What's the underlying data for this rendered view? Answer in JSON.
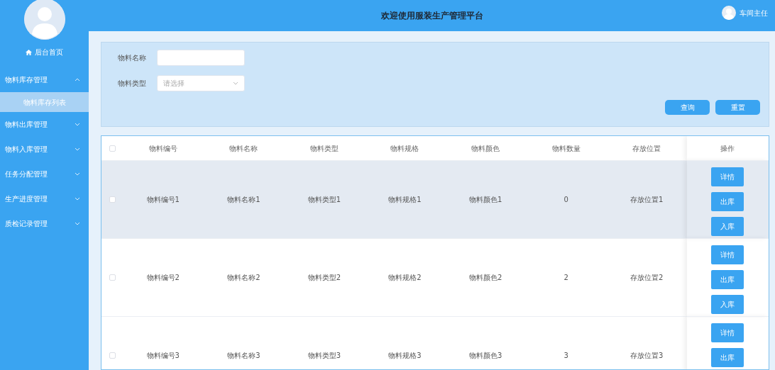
{
  "sidebar": {
    "home": "后台首页",
    "items": [
      {
        "label": "物料库存管理",
        "expanded": true,
        "children": [
          {
            "label": "物料库存列表",
            "selected": true
          }
        ]
      },
      {
        "label": "物料出库管理",
        "expanded": false
      },
      {
        "label": "物料入库管理",
        "expanded": false
      },
      {
        "label": "任务分配管理",
        "expanded": false
      },
      {
        "label": "生产进度管理",
        "expanded": false
      },
      {
        "label": "质检记录管理",
        "expanded": false
      }
    ]
  },
  "header": {
    "title": "欢迎使用服装生产管理平台",
    "user": "车间主任"
  },
  "search": {
    "fields": [
      {
        "kind": "text",
        "label": "物料名称"
      },
      {
        "kind": "select",
        "label": "物料类型",
        "placeholder": "请选择"
      }
    ],
    "buttons": [
      "查询",
      "重置"
    ]
  },
  "table": {
    "all_checked": false,
    "columns": [
      "物料编号",
      "物料名称",
      "物料类型",
      "物料规格",
      "物料颜色",
      "物料数量",
      "存放位置",
      "操作"
    ],
    "rows": [
      {
        "checked": false,
        "hovered": true,
        "cells": [
          "物料编号1",
          "物料名称1",
          "物料类型1",
          "物料规格1",
          "物料颜色1",
          "0",
          "存放位置1"
        ],
        "actions": [
          "详情",
          "出库",
          "入库"
        ]
      },
      {
        "checked": false,
        "hovered": false,
        "cells": [
          "物料编号2",
          "物料名称2",
          "物料类型2",
          "物料规格2",
          "物料颜色2",
          "2",
          "存放位置2"
        ],
        "actions": [
          "详情",
          "出库",
          "入库"
        ]
      },
      {
        "checked": false,
        "hovered": false,
        "cells": [
          "物料编号3",
          "物料名称3",
          "物料类型3",
          "物料规格3",
          "物料颜色3",
          "3",
          "存放位置3"
        ],
        "actions": [
          "详情",
          "出库"
        ]
      }
    ]
  }
}
